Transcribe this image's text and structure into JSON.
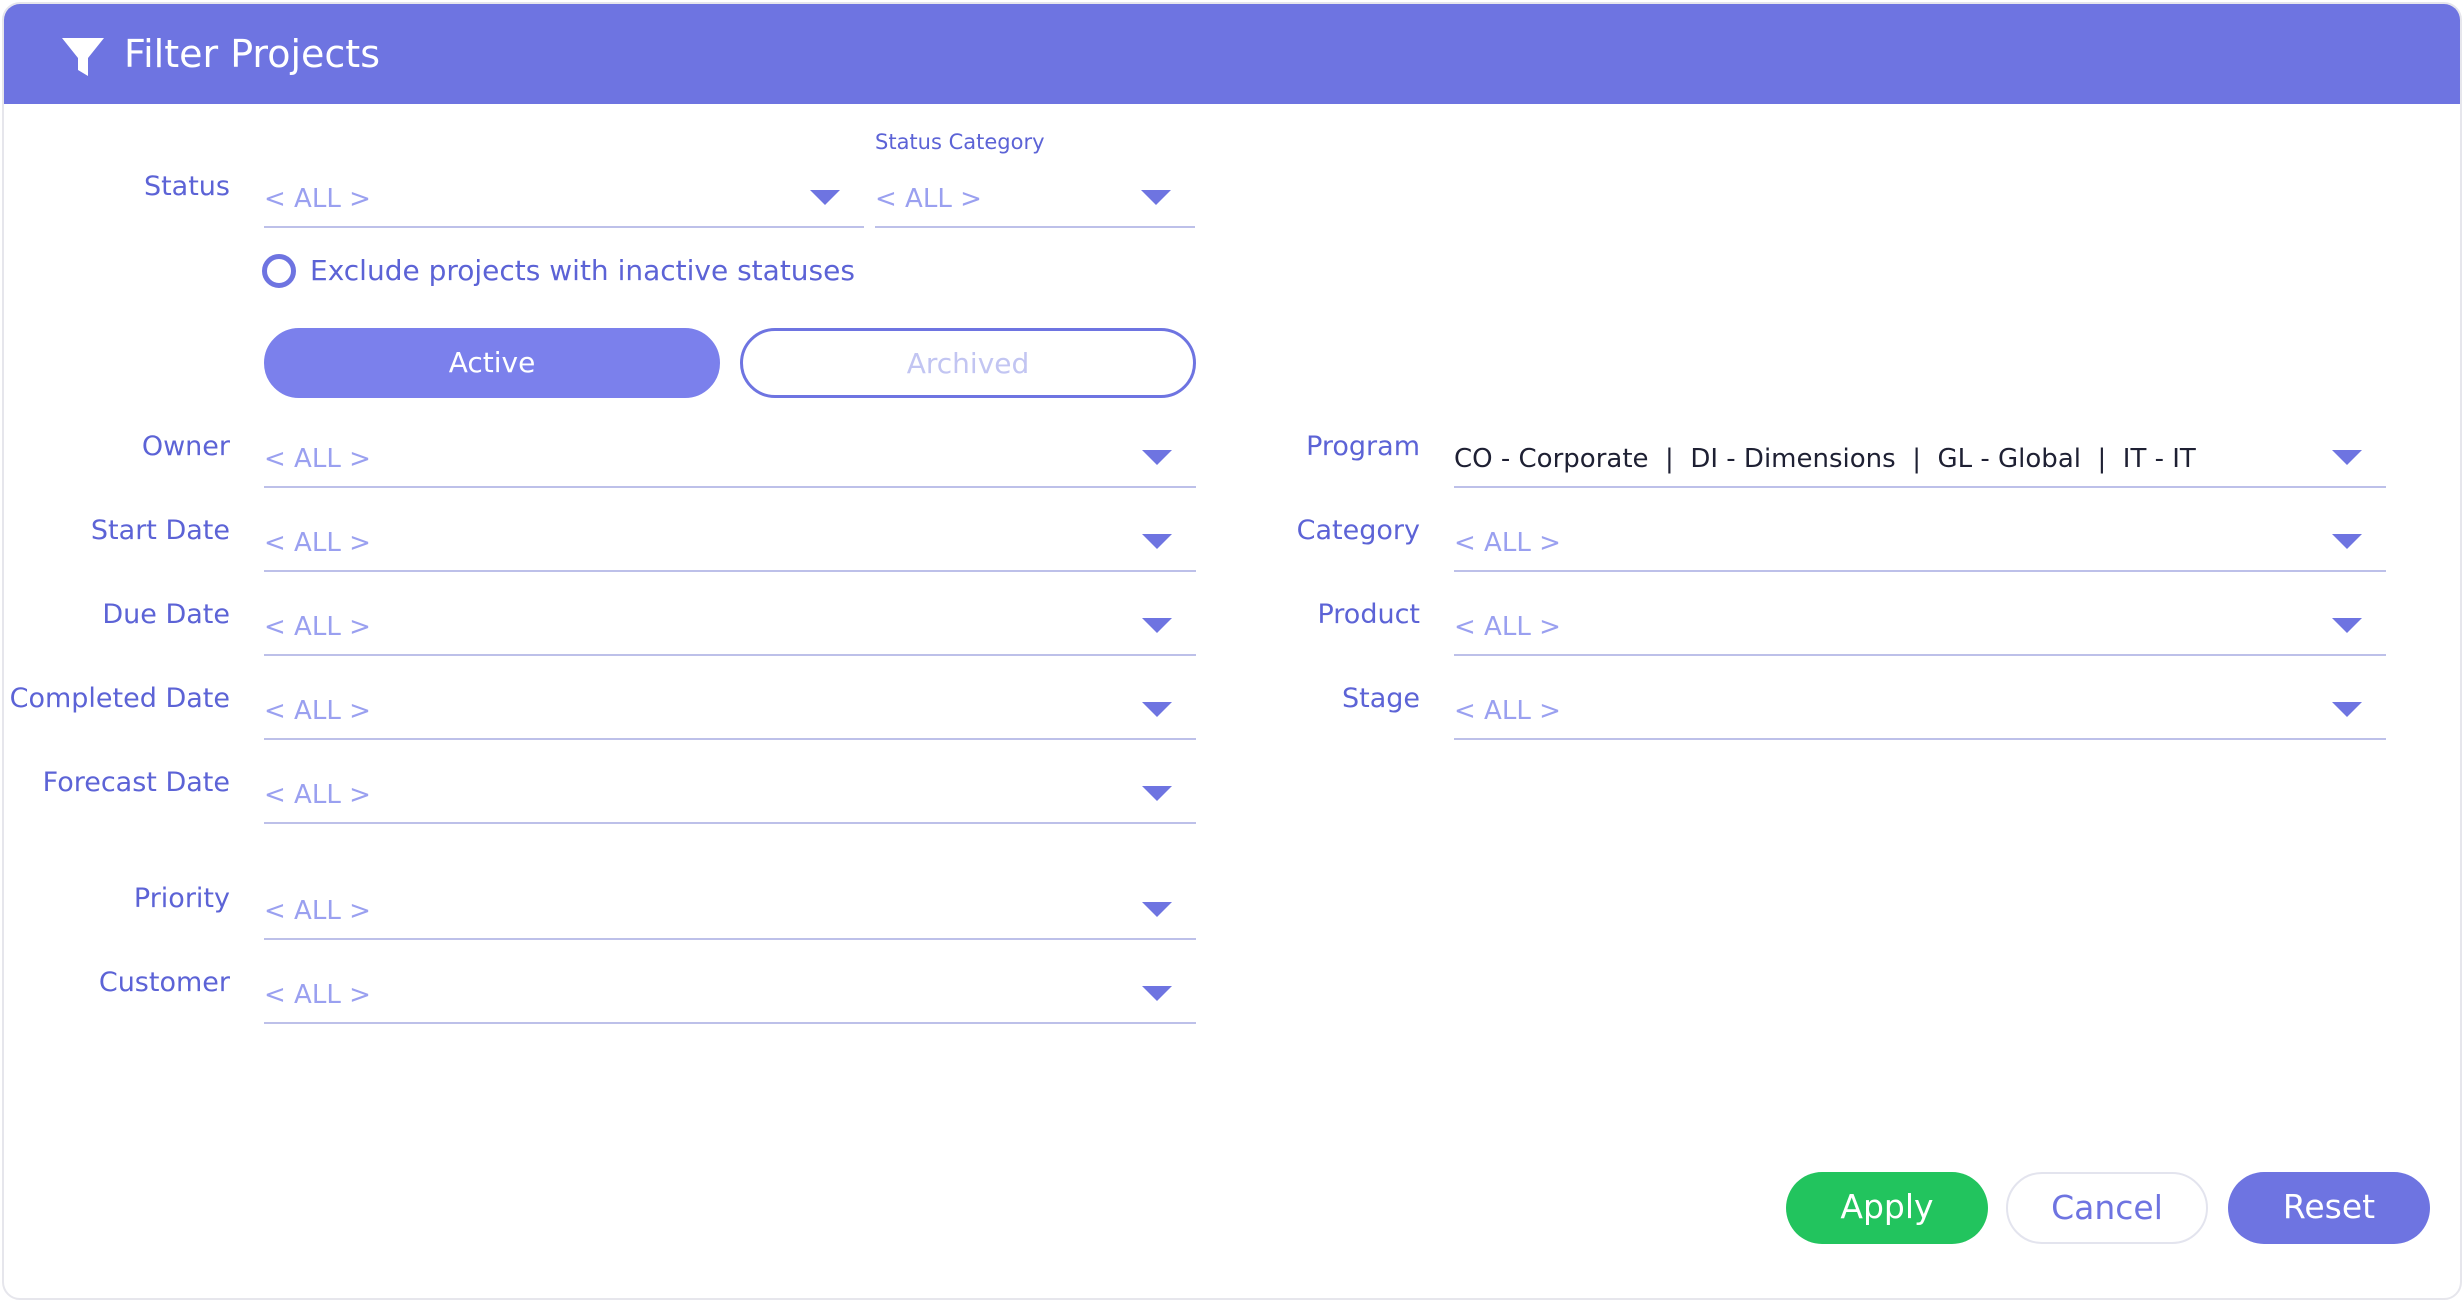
{
  "header": {
    "title": "Filter Projects",
    "icon": "filter-icon"
  },
  "fields": {
    "status": {
      "label": "Status",
      "value": "< ALL >"
    },
    "status_category": {
      "label": "Status Category",
      "value": "< ALL >"
    },
    "owner": {
      "label": "Owner",
      "value": "< ALL >"
    },
    "start_date": {
      "label": "Start Date",
      "value": "< ALL >"
    },
    "due_date": {
      "label": "Due Date",
      "value": "< ALL >"
    },
    "completed_date": {
      "label": "Completed Date",
      "value": "< ALL >"
    },
    "forecast_date": {
      "label": "Forecast Date",
      "value": "< ALL >"
    },
    "priority": {
      "label": "Priority",
      "value": "< ALL >"
    },
    "customer": {
      "label": "Customer",
      "value": "< ALL >"
    },
    "program": {
      "label": "Program",
      "value": "CO - Corporate  |  DI - Dimensions  |  GL - Global  |  IT - IT"
    },
    "category": {
      "label": "Category",
      "value": "< ALL >"
    },
    "product": {
      "label": "Product",
      "value": "< ALL >"
    },
    "stage": {
      "label": "Stage",
      "value": "< ALL >"
    }
  },
  "exclude_inactive": {
    "label": "Exclude projects with inactive statuses",
    "checked": false
  },
  "toggle": {
    "active_label": "Active",
    "archived_label": "Archived",
    "selected": "Active"
  },
  "buttons": {
    "apply": "Apply",
    "cancel": "Cancel",
    "reset": "Reset"
  },
  "colors": {
    "accent": "#6e74e1",
    "apply": "#22c45e",
    "placeholder": "#9aa0f0"
  }
}
